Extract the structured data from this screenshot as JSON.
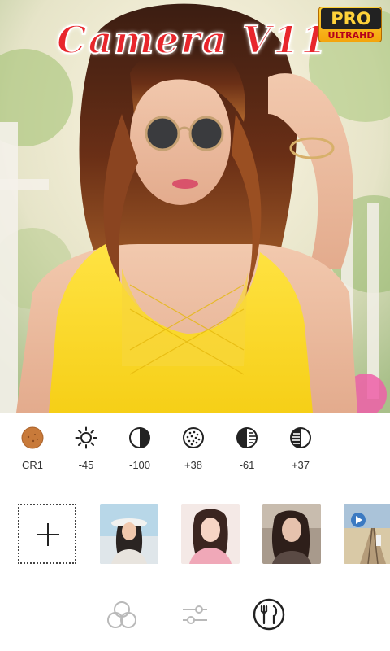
{
  "header": {
    "title": "Camera V11",
    "badge_main": "PRO",
    "badge_sub": "ULTRAHD"
  },
  "adjustments": [
    {
      "icon": "filter-dot-icon",
      "value": "CR1"
    },
    {
      "icon": "brightness-icon",
      "value": "-45"
    },
    {
      "icon": "contrast-icon",
      "value": "-100"
    },
    {
      "icon": "grain-icon",
      "value": "+38"
    },
    {
      "icon": "shadows-icon",
      "value": "-61"
    },
    {
      "icon": "highlights-icon",
      "value": "+37"
    }
  ],
  "thumbnails": [
    {
      "name": "thumb-girl-hat"
    },
    {
      "name": "thumb-girl-pink"
    },
    {
      "name": "thumb-girl-dark"
    },
    {
      "name": "thumb-railway"
    }
  ],
  "nav": [
    {
      "icon": "filters-circles-icon"
    },
    {
      "icon": "sliders-icon"
    },
    {
      "icon": "fork-knife-icon"
    }
  ],
  "colors": {
    "title_red": "#e8262c",
    "badge_gold": "#ffd23a",
    "icon_dark": "#222222",
    "filter_orange": "#c87a3a"
  }
}
